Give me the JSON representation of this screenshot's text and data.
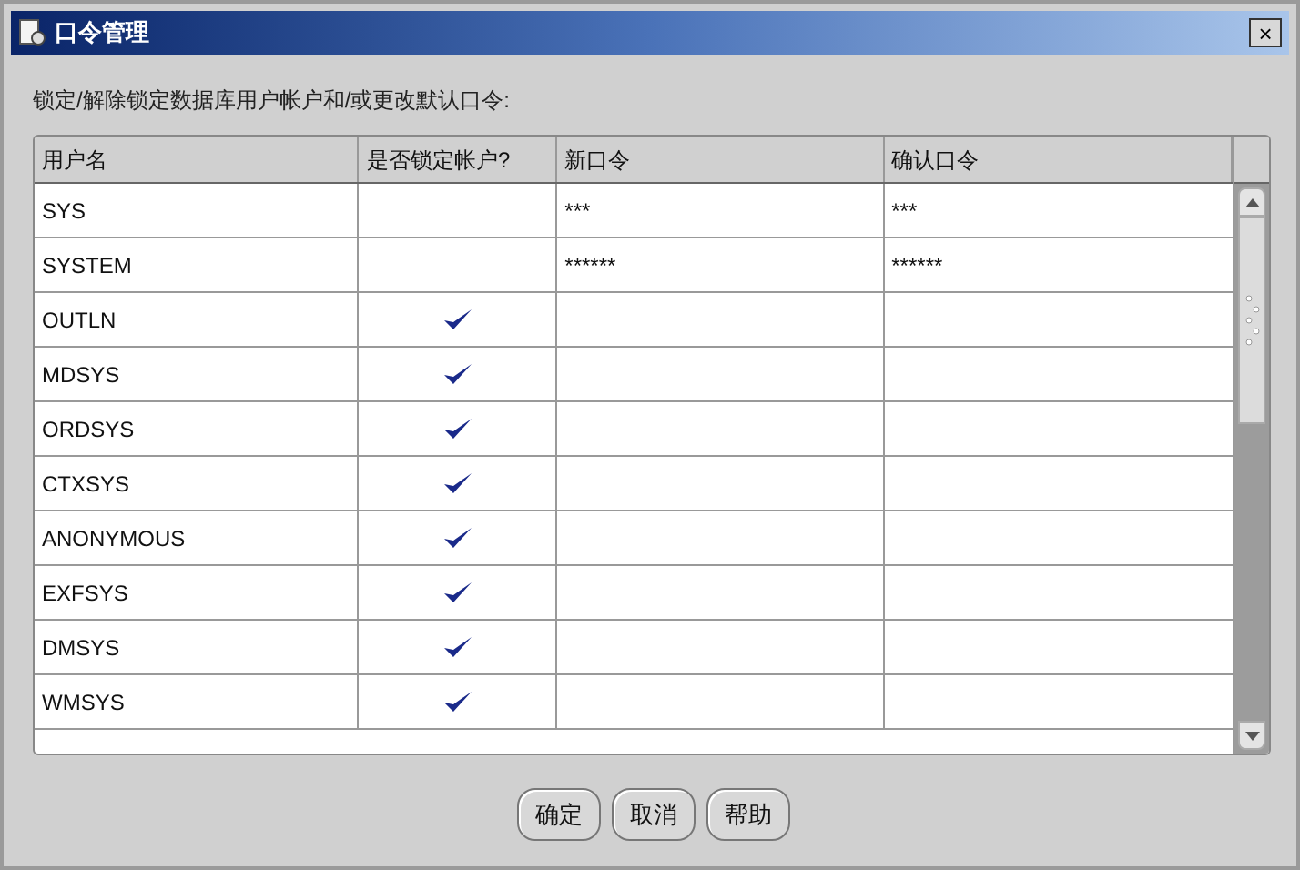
{
  "window": {
    "title": "口令管理",
    "close": "×"
  },
  "instruction": "锁定/解除锁定数据库用户帐户和/或更改默认口令:",
  "table": {
    "columns": [
      "用户名",
      "是否锁定帐户?",
      "新口令",
      "确认口令"
    ],
    "rows": [
      {
        "name": "SYS",
        "locked": false,
        "new_password": "***",
        "confirm_password": "***"
      },
      {
        "name": "SYSTEM",
        "locked": false,
        "new_password": "******",
        "confirm_password": "******"
      },
      {
        "name": "OUTLN",
        "locked": true
      },
      {
        "name": "MDSYS",
        "locked": true
      },
      {
        "name": "ORDSYS",
        "locked": true
      },
      {
        "name": "CTXSYS",
        "locked": true
      },
      {
        "name": "ANONYMOUS",
        "locked": true
      },
      {
        "name": "EXFSYS",
        "locked": true
      },
      {
        "name": "DMSYS",
        "locked": true
      },
      {
        "name": "WMSYS",
        "locked": true
      }
    ]
  },
  "buttons": [
    "确定",
    "取消",
    "帮助"
  ]
}
